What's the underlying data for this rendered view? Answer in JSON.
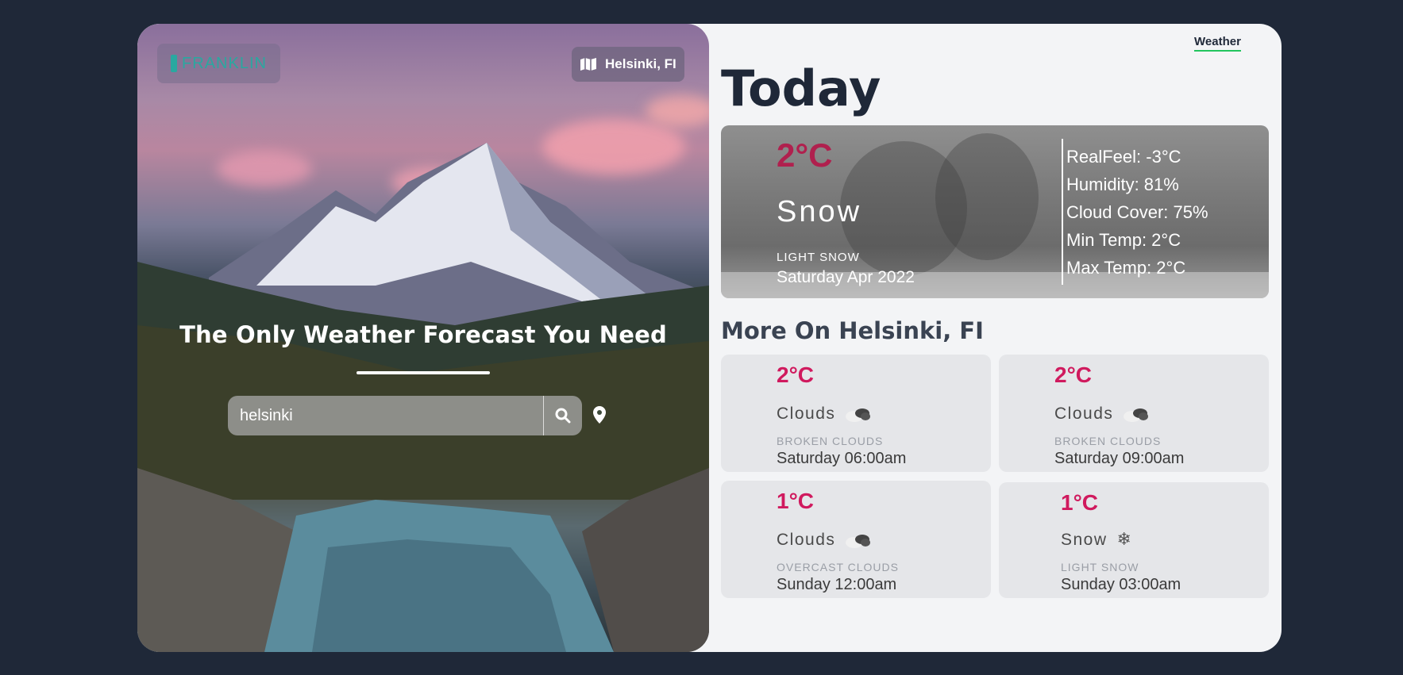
{
  "hero": {
    "logo_text": "FRANKLIN",
    "location_badge": "Helsinki, FI",
    "title": "The Only Weather Forecast You Need",
    "search_value": "helsinki"
  },
  "nav": {
    "weather_link": "Weather"
  },
  "today": {
    "heading": "Today",
    "temp": "2°C",
    "main": "Snow",
    "description": "LIGHT SNOW",
    "date": "Saturday Apr 2022",
    "stats": {
      "realfeel": "RealFeel: -3°C",
      "humidity": "Humidity: 81%",
      "cloud_cover": "Cloud Cover: 75%",
      "min_temp": "Min Temp: 2°C",
      "max_temp": "Max Temp: 2°C"
    }
  },
  "more": {
    "heading": "More On Helsinki, FI",
    "forecasts": [
      {
        "temp": "2°C",
        "main": "Clouds",
        "icon": "clouds-icon",
        "description": "BROKEN CLOUDS",
        "when": "Saturday 06:00am"
      },
      {
        "temp": "2°C",
        "main": "Clouds",
        "icon": "clouds-icon",
        "description": "BROKEN CLOUDS",
        "when": "Saturday 09:00am"
      },
      {
        "temp": "1°C",
        "main": "Clouds",
        "icon": "clouds-icon",
        "description": "OVERCAST CLOUDS",
        "when": "Sunday 12:00am"
      },
      {
        "temp": "1°C",
        "main": "Snow",
        "icon": "snowflake-icon",
        "description": "LIGHT SNOW",
        "when": "Sunday 03:00am"
      }
    ]
  },
  "colors": {
    "background": "#1f2838",
    "accent_temp": "#d01a5e",
    "nav_underline": "#22c55e"
  }
}
